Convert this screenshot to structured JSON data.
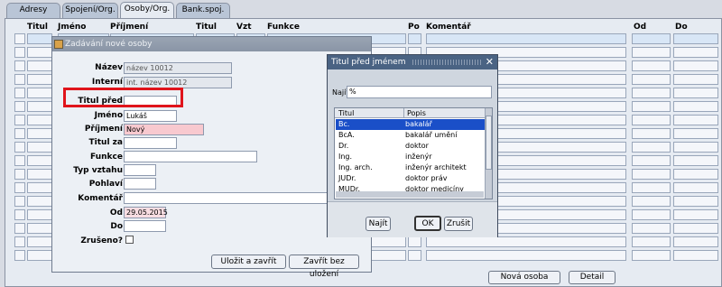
{
  "tabs": [
    {
      "label": "Adresy"
    },
    {
      "label": "Spojení/Org."
    },
    {
      "label": "Osoby/Org."
    },
    {
      "label": "Bank.spoj."
    }
  ],
  "columns": {
    "titul": "Titul",
    "jmeno": "Jméno",
    "prijmeni": "Příjmení",
    "titul2": "Titul",
    "vzt": "Vzt",
    "funkce": "Funkce",
    "po": "Po",
    "komentar": "Komentář",
    "od": "Od",
    "do": "Do"
  },
  "bottom_buttons": {
    "nova_osoba": "Nová osoba",
    "detail": "Detail"
  },
  "dialog": {
    "title": "Zadávání nové osoby",
    "labels": {
      "nazev": "Název",
      "interni": "Interní",
      "titul_pred": "Titul před",
      "jmeno": "Jméno",
      "prijmeni": "Příjmení",
      "titul_za": "Titul za",
      "funkce": "Funkce",
      "typ_vztahu": "Typ vztahu",
      "pohlavi": "Pohlaví",
      "komentar": "Komentář",
      "od": "Od",
      "do": "Do",
      "zruseno": "Zrušeno?"
    },
    "values": {
      "nazev": "název 10012",
      "interni": "int. název 10012",
      "titul_pred": "",
      "jmeno": "Lukáš",
      "prijmeni": "Nový",
      "titul_za": "",
      "funkce": "",
      "typ_vztahu": "",
      "pohlavi": "",
      "komentar": "",
      "od": "29.05.2015",
      "do": ""
    },
    "buttons": {
      "save_close": "Uložit a zavřít",
      "close_nosave": "Zavřít bez uložení"
    }
  },
  "lov": {
    "title": "Titul před jménem",
    "find_label": "Najít",
    "find_value": "%",
    "headers": {
      "titul": "Titul",
      "popis": "Popis"
    },
    "rows": [
      {
        "titul": "Bc.",
        "popis": "bakalář"
      },
      {
        "titul": "BcA.",
        "popis": "bakalář umění"
      },
      {
        "titul": "Dr.",
        "popis": "doktor"
      },
      {
        "titul": "Ing.",
        "popis": "inženýr"
      },
      {
        "titul": "Ing. arch.",
        "popis": "inženýr architekt"
      },
      {
        "titul": "JUDr.",
        "popis": "doktor práv"
      },
      {
        "titul": "MUDr.",
        "popis": "doktor medicíny"
      }
    ],
    "buttons": {
      "najit": "Najít",
      "ok": "OK",
      "zrusit": "Zrušit"
    }
  }
}
